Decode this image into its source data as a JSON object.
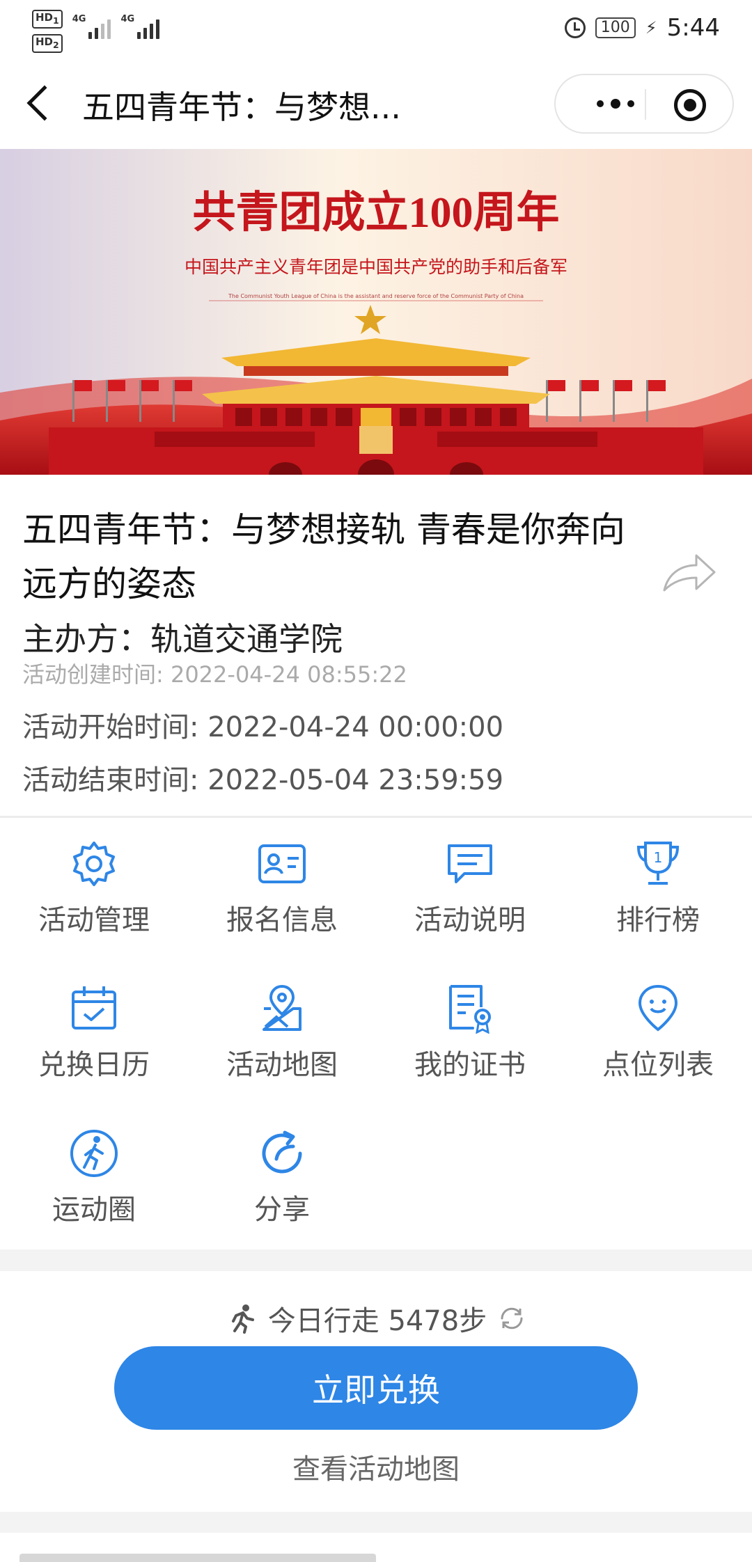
{
  "status_bar": {
    "sim1": "HD",
    "sim1_sub": "1",
    "sim2": "HD",
    "sim2_sub": "2",
    "network1": "4G",
    "network2": "4G",
    "battery": "100",
    "time": "5:44"
  },
  "nav": {
    "title": "五四青年节：与梦想...",
    "more_icon": "more-dots-icon",
    "close_icon": "target-icon"
  },
  "banner": {
    "headline": "共青团成立100周年",
    "subline": "中国共产主义青年团是中国共产党的助手和后备军",
    "english_line": "The Communist Youth League of China is the assistant and reserve force of the Communist Party of China",
    "colors": {
      "red": "#c4161c",
      "gold": "#f2b733",
      "sky": "#fbe9dd"
    }
  },
  "activity": {
    "title": "五四青年节：与梦想接轨 青春是你奔向远方的姿态",
    "organizer": "主办方：轨道交通学院",
    "created": "活动创建时间: 2022-04-24 08:55:22",
    "start": "活动开始时间: 2022-04-24 00:00:00",
    "end": "活动结束时间: 2022-05-04 23:59:59"
  },
  "menu": {
    "icon_color": "#2e86e6",
    "items": [
      {
        "label": "活动管理",
        "icon": "gear-icon"
      },
      {
        "label": "报名信息",
        "icon": "id-card-icon"
      },
      {
        "label": "活动说明",
        "icon": "message-icon"
      },
      {
        "label": "排行榜",
        "icon": "trophy-icon"
      },
      {
        "label": "兑换日历",
        "icon": "calendar-check-icon"
      },
      {
        "label": "活动地图",
        "icon": "map-pin-icon"
      },
      {
        "label": "我的证书",
        "icon": "certificate-icon"
      },
      {
        "label": "点位列表",
        "icon": "location-smile-icon"
      },
      {
        "label": "运动圈",
        "icon": "walking-circle-icon"
      },
      {
        "label": "分享",
        "icon": "share-refresh-icon"
      }
    ]
  },
  "steps": {
    "text": "今日行走 5478步",
    "run_icon": "running-icon",
    "refresh_icon": "refresh-icon"
  },
  "actions": {
    "redeem": "立即兑换",
    "view_map": "查看活动地图",
    "accent": "#2e86e6"
  }
}
